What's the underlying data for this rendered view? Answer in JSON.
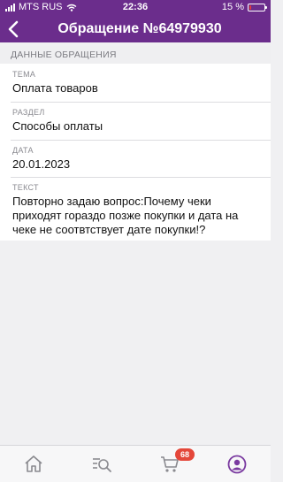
{
  "status_bar": {
    "carrier": "MTS RUS",
    "time": "22:36",
    "battery_percent": "15 %",
    "battery_level": 0.15
  },
  "header": {
    "title": "Обращение №64979930",
    "back_icon": "chevron-left-icon"
  },
  "section": {
    "title": "ДАННЫЕ ОБРАЩЕНИЯ"
  },
  "fields": [
    {
      "label": "ТЕМА",
      "value": "Оплата товаров"
    },
    {
      "label": "РАЗДЕЛ",
      "value": "Способы оплаты"
    },
    {
      "label": "ДАТА",
      "value": "20.01.2023"
    },
    {
      "label": "ТЕКСТ",
      "value": "Повторно задаю вопрос:Почему чеки приходят гораздо позже покупки и дата на чеке не соотвтствует дате покупки!?"
    }
  ],
  "tabbar": {
    "cart_badge": "68",
    "accent_color": "#7a3aa0"
  }
}
